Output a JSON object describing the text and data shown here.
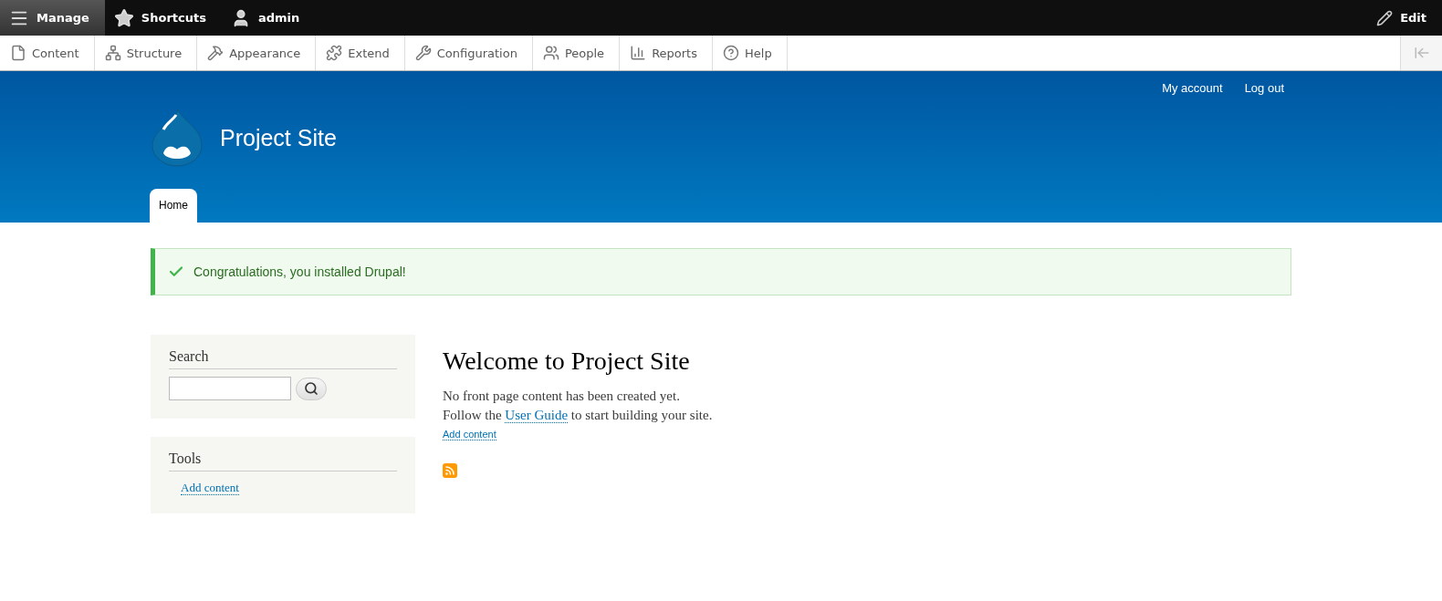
{
  "toolbar": {
    "items": [
      {
        "kind": "menu",
        "label": "Manage",
        "selected": true
      },
      {
        "kind": "star",
        "label": "Shortcuts",
        "selected": false
      },
      {
        "kind": "user",
        "label": "admin",
        "selected": false
      }
    ],
    "edit": "Edit"
  },
  "admin_menu": [
    {
      "kind": "content",
      "label": "Content"
    },
    {
      "kind": "structure",
      "label": "Structure"
    },
    {
      "kind": "appearance",
      "label": "Appearance"
    },
    {
      "kind": "extend",
      "label": "Extend"
    },
    {
      "kind": "configuration",
      "label": "Configuration"
    },
    {
      "kind": "people",
      "label": "People"
    },
    {
      "kind": "reports",
      "label": "Reports"
    },
    {
      "kind": "help",
      "label": "Help"
    }
  ],
  "header": {
    "secondary_links": [
      "My account",
      "Log out"
    ],
    "site_name": "Project Site",
    "tabs": [
      {
        "label": "Home",
        "selected": true
      }
    ]
  },
  "message": "Congratulations, you installed Drupal!",
  "sidebar": {
    "search": {
      "title": "Search"
    },
    "tools": {
      "title": "Tools",
      "links": [
        "Add content"
      ]
    }
  },
  "main": {
    "title": "Welcome to Project Site",
    "line_1": "No front page content has been created yet.",
    "line_2": {
      "before": "Follow the",
      "link": "User Guide",
      "after": "to start building your site."
    },
    "add_link": "Add content"
  }
}
